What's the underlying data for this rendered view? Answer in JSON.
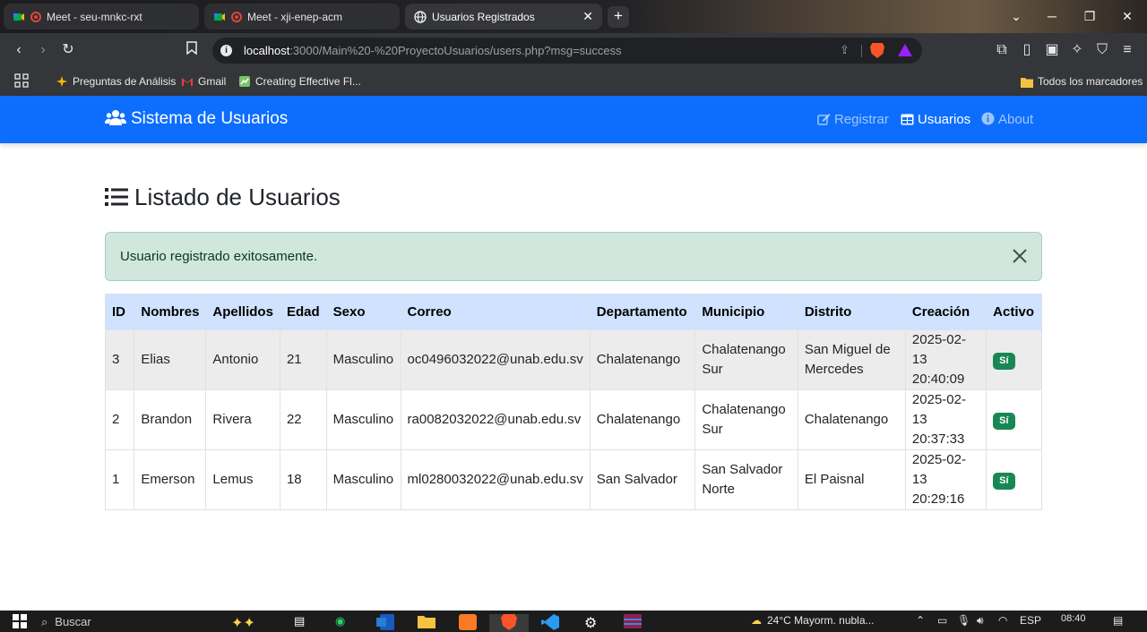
{
  "browser": {
    "tabs": [
      {
        "title": "Meet - seu-mnkc-rxt",
        "active": false
      },
      {
        "title": "Meet - xji-enep-acm",
        "active": false
      },
      {
        "title": "Usuarios Registrados",
        "active": true
      }
    ],
    "url_host": "localhost",
    "url_rest": ":3000/Main%20-%20ProyectoUsuarios/users.php?msg=success",
    "bookmarks": [
      "Preguntas de Análisis",
      "Gmail",
      "Creating Effective Fl..."
    ],
    "bookmarks_folder": "Todos los marcadores"
  },
  "navbar": {
    "brand": "Sistema de Usuarios",
    "links": [
      {
        "label": "Registrar",
        "active": false
      },
      {
        "label": "Usuarios",
        "active": true
      },
      {
        "label": "About",
        "active": false
      }
    ]
  },
  "page": {
    "title": "Listado de Usuarios",
    "alert": "Usuario registrado exitosamente."
  },
  "table": {
    "headers": [
      "ID",
      "Nombres",
      "Apellidos",
      "Edad",
      "Sexo",
      "Correo",
      "Departamento",
      "Municipio",
      "Distrito",
      "Creación",
      "Activo"
    ],
    "rows": [
      {
        "id": "3",
        "nombres": "Elias",
        "apellidos": "Antonio",
        "edad": "21",
        "sexo": "Masculino",
        "correo": "oc0496032022@unab.edu.sv",
        "departamento": "Chalatenango",
        "municipio": "Chalatenango Sur",
        "distrito": "San Miguel de Mercedes",
        "creacion": "2025-02-13 20:40:09",
        "activo": "Sí"
      },
      {
        "id": "2",
        "nombres": "Brandon",
        "apellidos": "Rivera",
        "edad": "22",
        "sexo": "Masculino",
        "correo": "ra0082032022@unab.edu.sv",
        "departamento": "Chalatenango",
        "municipio": "Chalatenango Sur",
        "distrito": "Chalatenango",
        "creacion": "2025-02-13 20:37:33",
        "activo": "Sí"
      },
      {
        "id": "1",
        "nombres": "Emerson",
        "apellidos": "Lemus",
        "edad": "18",
        "sexo": "Masculino",
        "correo": "ml0280032022@unab.edu.sv",
        "departamento": "San Salvador",
        "municipio": "San Salvador Norte",
        "distrito": "El Paisnal",
        "creacion": "2025-02-13 20:29:16",
        "activo": "Sí"
      }
    ]
  },
  "taskbar": {
    "search_placeholder": "Buscar",
    "weather": "24°C  Mayorm. nubla...",
    "language": "ESP",
    "time": "08:40"
  },
  "colors": {
    "navbar": "#0d6efd",
    "table_header": "#cfe2ff",
    "alert_bg": "#d1e7dd",
    "badge": "#198754"
  }
}
